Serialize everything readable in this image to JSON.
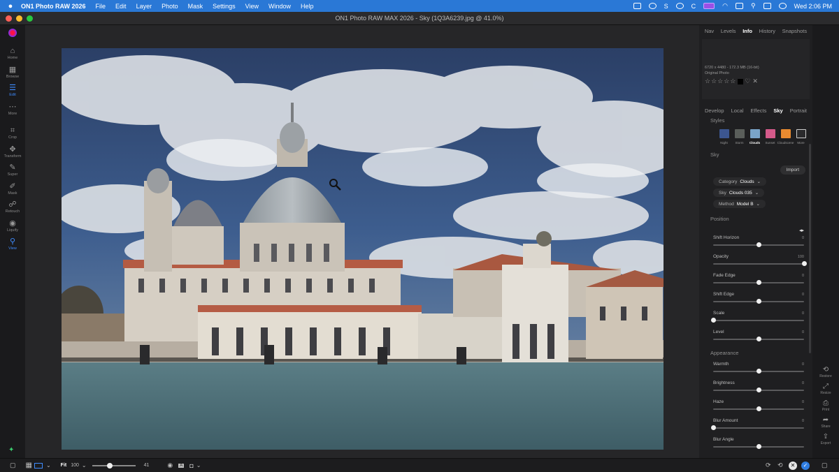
{
  "menubar": {
    "app_name": "ON1 Photo RAW 2026",
    "items": [
      "File",
      "Edit",
      "Layer",
      "Photo",
      "Mask",
      "Settings",
      "View",
      "Window",
      "Help"
    ],
    "clock": "Wed 2:06 PM"
  },
  "window": {
    "title": "ON1 Photo RAW MAX 2026 - Sky (1Q3A6239.jpg @ 41.0%)"
  },
  "left_tools": [
    {
      "label": "Home",
      "icon": "home-icon",
      "glyph": "⌂"
    },
    {
      "label": "Browse",
      "icon": "browse-icon",
      "glyph": "▦"
    },
    {
      "label": "Edit",
      "icon": "edit-icon",
      "glyph": "☰",
      "active": true
    },
    {
      "label": "More",
      "icon": "more-icon",
      "glyph": "⋯"
    },
    {
      "label": "Crop",
      "icon": "crop-icon",
      "glyph": "⌗"
    },
    {
      "label": "Transform",
      "icon": "transform-icon",
      "glyph": "✥"
    },
    {
      "label": "Super",
      "icon": "brush-icon",
      "glyph": "✎"
    },
    {
      "label": "Mask",
      "icon": "mask-icon",
      "glyph": "✐"
    },
    {
      "label": "Retouch",
      "icon": "retouch-icon",
      "glyph": "☍"
    },
    {
      "label": "Liquify",
      "icon": "liquify-icon",
      "glyph": "◉"
    },
    {
      "label": "View",
      "icon": "zoom-icon",
      "glyph": "⚲",
      "active": true
    }
  ],
  "panel_tabs": [
    "Nav",
    "Levels",
    "Info",
    "History",
    "Snapshots"
  ],
  "panel_tab_active": "Info",
  "info": {
    "dimensions": "6720 x 4480 - 172.3 MB (16-bit)",
    "photo_type": "Original Photo",
    "rating": 0
  },
  "develop_tabs": [
    "Develop",
    "Local",
    "Effects",
    "Sky",
    "Portrait"
  ],
  "develop_tab_active": "Sky",
  "styles": {
    "heading": "Styles",
    "items": [
      {
        "name": "Night",
        "color": "#3c5690"
      },
      {
        "name": "Storm",
        "color": "#5a5e5a"
      },
      {
        "name": "Clouds",
        "color": "#7aa4c8",
        "active": true
      },
      {
        "name": "Sunset",
        "color": "#d45a8a"
      },
      {
        "name": "Cloudscene",
        "color": "#e88a30"
      },
      {
        "name": "More",
        "color": "#2a2a2c"
      }
    ]
  },
  "sky": {
    "heading": "Sky",
    "import_label": "Import",
    "category_label": "Category",
    "category_value": "Clouds",
    "sky_label": "Sky",
    "sky_value": "Clouds 035",
    "method_label": "Method",
    "method_value": "Model B"
  },
  "position": {
    "heading": "Position",
    "sliders": [
      {
        "label": "Shift Horizon",
        "value": "0",
        "level": 0.5
      },
      {
        "label": "Opacity",
        "value": "100",
        "level": 1.0
      },
      {
        "label": "Fade Edge",
        "value": "0",
        "level": 0.5
      },
      {
        "label": "Shift Edge",
        "value": "0",
        "level": 0.5
      },
      {
        "label": "Scale",
        "value": "0",
        "level": 0.0
      },
      {
        "label": "Level",
        "value": "0",
        "level": 0.5
      }
    ]
  },
  "appearance": {
    "heading": "Appearance",
    "sliders": [
      {
        "label": "Warmth",
        "value": "0",
        "level": 0.5
      },
      {
        "label": "Brightness",
        "value": "0",
        "level": 0.5
      },
      {
        "label": "Haze",
        "value": "0",
        "level": 0.5
      },
      {
        "label": "Blur Amount",
        "value": "0",
        "level": 0.0
      },
      {
        "label": "Blur Angle",
        "value": "",
        "level": 0.5
      }
    ]
  },
  "right_tools": [
    {
      "label": "Restore",
      "icon": "restore-icon",
      "glyph": "⟲"
    },
    {
      "label": "Resize",
      "icon": "resize-icon",
      "glyph": "⤢"
    },
    {
      "label": "Print",
      "icon": "print-icon",
      "glyph": "⎙"
    },
    {
      "label": "Share",
      "icon": "share-icon",
      "glyph": "➦"
    },
    {
      "label": "Export",
      "icon": "export-icon",
      "glyph": "⇪"
    }
  ],
  "bottombar": {
    "fit_label": "Fit",
    "zoom_value": "100",
    "slider_value": "41",
    "zoom_level": 0.41
  },
  "colors": {
    "accent": "#2a78d6",
    "active_tool": "#3f8cff"
  }
}
